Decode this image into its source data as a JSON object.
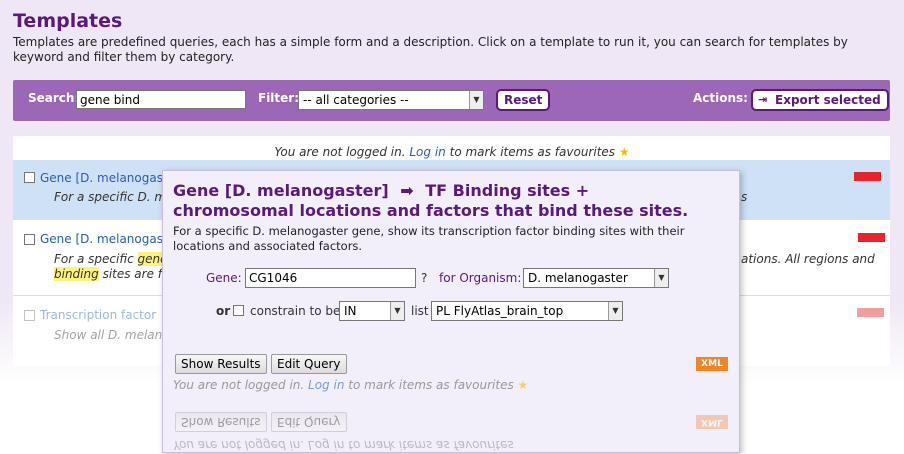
{
  "header": {
    "title": "Templates",
    "description": "Templates are predefined queries, each has a simple form and a description. Click on a template to run it, you can search for templates by keyword and filter them by category."
  },
  "search_bar": {
    "search_label": "Search:",
    "search_value": "gene bind",
    "filter_label": "Filter:",
    "filter_value": "-- all categories --",
    "reset_label": "Reset",
    "actions_label": "Actions:",
    "export_label": "Export selected"
  },
  "login": {
    "prefix": "You are not logged in.",
    "link": "Log in",
    "suffix": "to mark items as favourites"
  },
  "templates": [
    {
      "title": "Gene [D. melanogaster",
      "desc": "For a specific D. m",
      "desc_tail": "s"
    },
    {
      "title": "Gene [D. melanogaster",
      "desc_start": "For a specific",
      "desc_hl1": "gene",
      "desc_hl2": "binding",
      "desc_line2_rest": "sites are f",
      "desc_tail": "ations. All regions and"
    },
    {
      "title": "Transcription factor",
      "desc": "Show all D. melano"
    }
  ],
  "popup": {
    "title_part1": "Gene [D. melanogaster]",
    "title_arrow": "➡",
    "title_part2": "TF Binding sites +",
    "title_line2": "chromosomal locations and factors that bind these sites.",
    "description": "For a specific D. melanogaster gene, show its transcription factor binding sites with their locations and associated factors.",
    "gene_label": "Gene:",
    "gene_value": "CG1046",
    "help_mark": "?",
    "organism_label": "for Organism:",
    "organism_value": "D. melanogaster",
    "or_label": "or",
    "constrain_label": "constrain to be",
    "constrain_op": "IN",
    "list_label": "list",
    "list_value": "PL FlyAtlas_brain_top",
    "show_results_label": "Show Results",
    "edit_query_label": "Edit Query",
    "xml_label": "XML",
    "footer_prefix": "You are not logged in.",
    "footer_link": "Log in",
    "footer_suffix": "to mark items as favourites"
  },
  "colors": {
    "accent": "#9b67b6",
    "brand": "#5a1a7a",
    "link": "#2a5db0",
    "badge": "#e8242a",
    "xml": "#f08528"
  }
}
